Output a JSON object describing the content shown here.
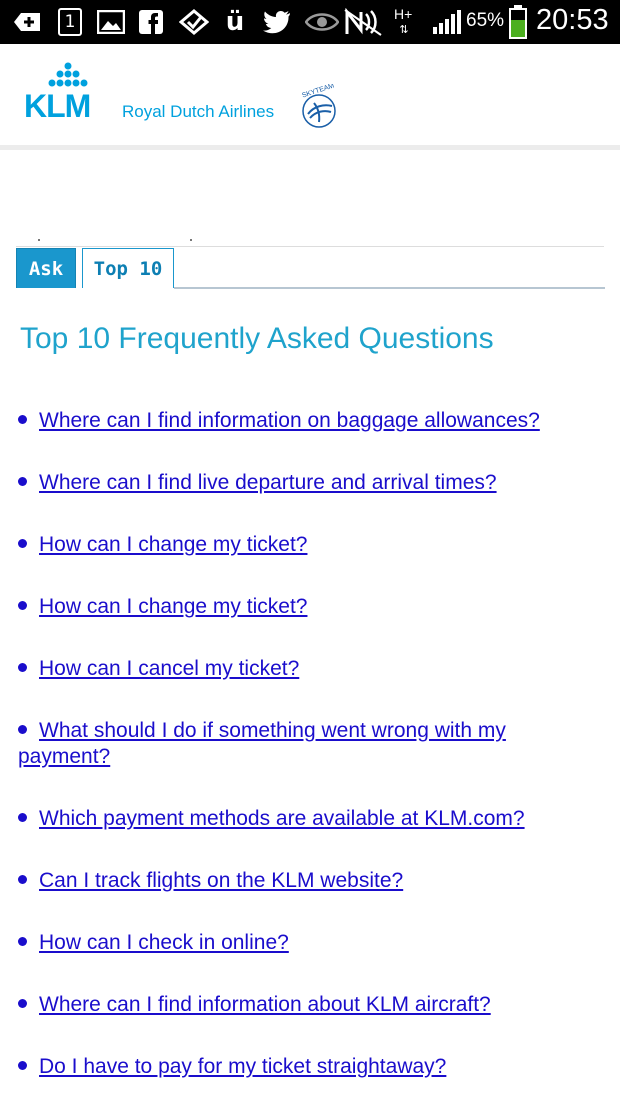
{
  "status_bar": {
    "battery_percent": "65%",
    "time": "20:53",
    "network": "H+",
    "notification_count": "1",
    "icons": [
      "plus-icon",
      "calendar-icon",
      "gallery-icon",
      "facebook-icon",
      "checkmark-icon",
      "app-u-icon",
      "twitter-icon",
      "eye-icon",
      "nfc-icon",
      "network-icon",
      "signal-icon",
      "battery-icon"
    ]
  },
  "header": {
    "brand": "KLM",
    "tagline": "Royal Dutch Airlines",
    "skyteam_label": "SKYTEAM",
    "brand_color": "#00a1de"
  },
  "tabs": [
    {
      "label": "Ask",
      "active": false
    },
    {
      "label": "Top 10",
      "active": true
    }
  ],
  "main": {
    "title": "Top 10 Frequently Asked Questions",
    "questions": [
      "Where can I find information on baggage allowances?",
      "Where can I find live departure and arrival times?",
      "How can I change my ticket?",
      "How can I change my ticket?",
      "How can I cancel my ticket?",
      "What should I do if something went wrong with my payment?",
      "Which payment methods are available at KLM.com?",
      "Can I track flights on the KLM website?",
      "How can I check in online?",
      "Where can I find information about KLM aircraft?",
      "Do I have to pay for my ticket straightaway?"
    ]
  },
  "colors": {
    "link": "#1a0dcc",
    "title": "#1fa3cc",
    "tab_active_bg": "#1a97cd"
  }
}
